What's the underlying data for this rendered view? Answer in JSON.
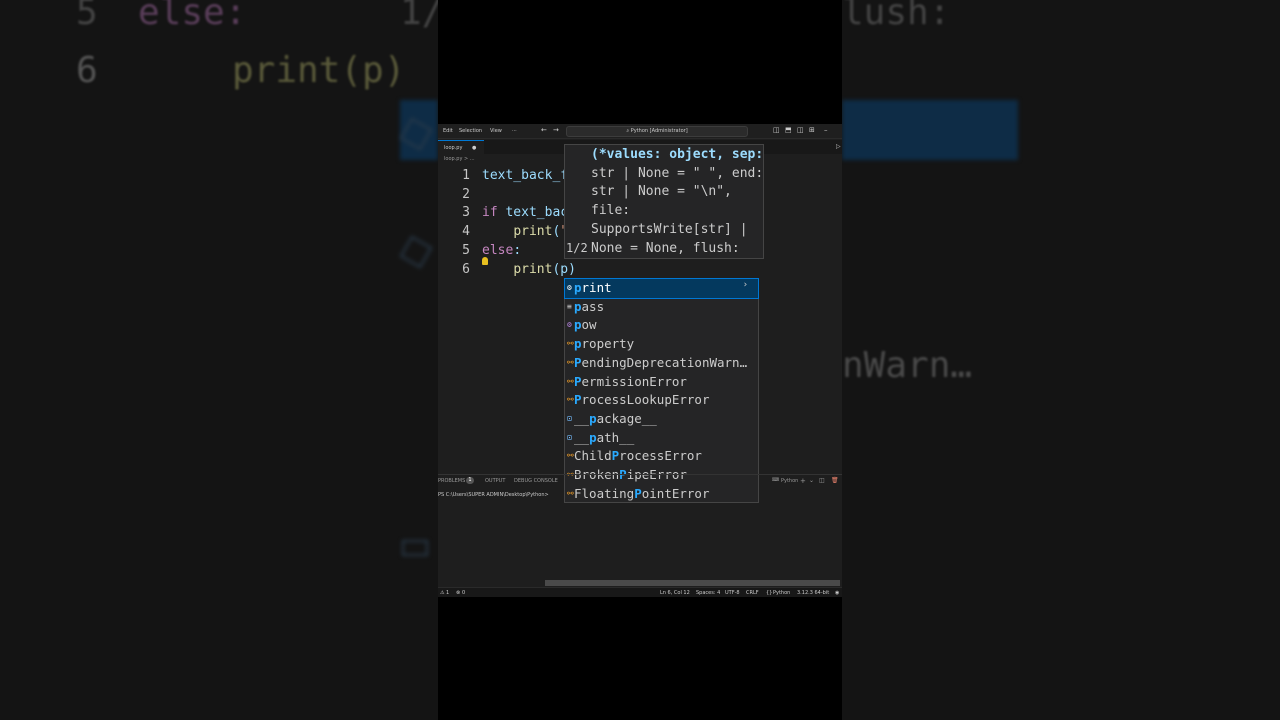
{
  "window": {
    "menu": [
      "Edit",
      "Selection",
      "View",
      "···"
    ],
    "command_center": "Python [Administrator]"
  },
  "tab": {
    "label": "loop.py"
  },
  "breadcrumb": "loop.py > ...",
  "editor": {
    "lines": [
      {
        "n": "1",
        "parts": [
          [
            "id",
            "text_back_f"
          ]
        ]
      },
      {
        "n": "2",
        "parts": []
      },
      {
        "n": "3",
        "parts": [
          [
            "kw",
            "if"
          ],
          [
            "id",
            " text_bac"
          ]
        ]
      },
      {
        "n": "4",
        "parts": [
          [
            "id",
            "    "
          ],
          [
            "fn",
            "print"
          ],
          [
            "id",
            "("
          ],
          [
            "str",
            "\""
          ]
        ]
      },
      {
        "n": "5",
        "parts": [
          [
            "kw",
            "else"
          ],
          [
            "id",
            ":"
          ]
        ]
      },
      {
        "n": "6",
        "parts": [
          [
            "id",
            "    "
          ],
          [
            "fn",
            "print"
          ],
          [
            "id",
            "(p)"
          ]
        ]
      }
    ]
  },
  "signature_help": {
    "lines": [
      "(*values: object, sep:",
      "str | None = \" \", end:",
      "str | None = \"\\n\",",
      "file:",
      "SupportsWrite[str] |",
      "None = None, flush:"
    ],
    "page": "1/2"
  },
  "suggestions": [
    {
      "label": "print",
      "icon": "method-icon",
      "selected": true
    },
    {
      "label": "pass",
      "icon": "keyword-icon",
      "selected": false
    },
    {
      "label": "pow",
      "icon": "method-icon",
      "selected": false
    },
    {
      "label": "property",
      "icon": "class-icon",
      "selected": false
    },
    {
      "label": "PendingDeprecationWarn…",
      "icon": "class-icon",
      "selected": false
    },
    {
      "label": "PermissionError",
      "icon": "class-icon",
      "selected": false
    },
    {
      "label": "ProcessLookupError",
      "icon": "class-icon",
      "selected": false
    },
    {
      "label": "__package__",
      "icon": "variable-icon",
      "selected": false
    },
    {
      "label": "__path__",
      "icon": "variable-icon",
      "selected": false
    },
    {
      "label": "ChildProcessError",
      "icon": "class-icon",
      "selected": false
    },
    {
      "label": "BrokenPipeError",
      "icon": "class-icon",
      "selected": false
    },
    {
      "label": "FloatingPointError",
      "icon": "class-icon",
      "selected": false
    }
  ],
  "panel": {
    "tabs": [
      "PROBLEMS",
      "OUTPUT",
      "DEBUG CONSOLE"
    ],
    "problems_count": "1",
    "terminal_label": "Python",
    "terminal_prompt": "PS C:\\Users\\SUPER ADMIN\\Desktop\\Python>"
  },
  "status": {
    "errors": "1",
    "warnings": "0",
    "position": "Ln 6, Col 12",
    "spaces": "Spaces: 4",
    "encoding": "UTF-8",
    "eol": "CRLF",
    "language": "Python",
    "interpreter": "3.12.3 64-bit"
  },
  "background": {
    "left_lines": [
      {
        "n": "5",
        "text": "else:"
      },
      {
        "n": "6",
        "text": "print(p)"
      }
    ],
    "right_top": "lush:",
    "right_mid": "nWarn…",
    "left_top": "1/"
  }
}
